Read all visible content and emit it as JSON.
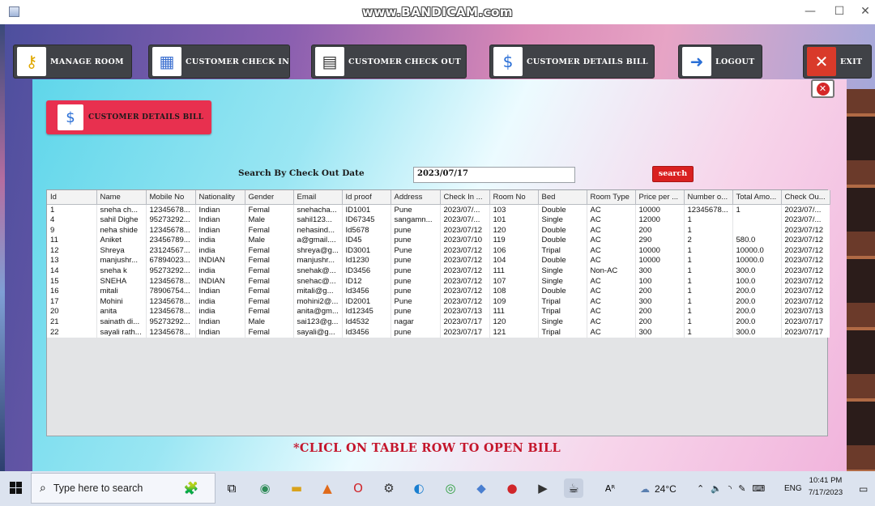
{
  "window": {
    "watermark": "www.BANDICAM.com",
    "minimize": "—",
    "maximize": "☐",
    "close": "✕"
  },
  "nav": [
    {
      "label": "MANAGE ROOM",
      "icon": "key-icon"
    },
    {
      "label": "CUSTOMER CHECK IN",
      "icon": "hotel-icon"
    },
    {
      "label": "CUSTOMER CHECK OUT",
      "icon": "checkout-icon"
    },
    {
      "label": "CUSTOMER DETAILS BILL",
      "icon": "bill-icon"
    },
    {
      "label": "LOGOUT",
      "icon": "logout-icon"
    },
    {
      "label": "EXIT",
      "icon": "exit-icon"
    }
  ],
  "header": {
    "label": "CUSTOMER DETAILS BILL"
  },
  "search": {
    "label": "Search By Check Out Date",
    "value": "2023/07/17",
    "button": "search"
  },
  "table": {
    "columns": [
      "Id",
      "Name",
      "Mobile No",
      "Nationality",
      "Gender",
      "Email",
      "Id proof",
      "Address",
      "Check In ...",
      "Room No",
      "Bed",
      "Room Type",
      "Price per ...",
      "Number o...",
      "Total Amo...",
      "Check Ou..."
    ],
    "rows": [
      [
        "1",
        "sneha ch...",
        "12345678...",
        "Indian",
        "Femal",
        "snehacha...",
        "ID1001",
        "Pune",
        "2023/07/...",
        "103",
        "Double",
        "AC",
        "10000",
        "12345678...",
        "1",
        "2023/07/..."
      ],
      [
        "4",
        "sahil Dighe",
        "95273292...",
        "Indian",
        "Male",
        "sahil123...",
        "ID67345",
        "sangamn...",
        "2023/07/...",
        "101",
        "Single",
        "AC",
        "12000",
        "1",
        "",
        "2023/07/..."
      ],
      [
        "9",
        "neha shide",
        "12345678...",
        "Indian",
        "Femal",
        "nehasind...",
        "Id5678",
        "pune",
        "2023/07/12",
        "120",
        "Double",
        "AC",
        "200",
        "1",
        "",
        "2023/07/12"
      ],
      [
        "11",
        "Aniket",
        "23456789...",
        "india",
        "Male",
        "a@gmail....",
        "ID45",
        "pune",
        "2023/07/10",
        "119",
        "Double",
        "AC",
        "290",
        "2",
        "580.0",
        "2023/07/12"
      ],
      [
        "12",
        "Shreya",
        "23124567...",
        "india",
        "Femal",
        "shreya@g...",
        "ID3001",
        "Pune",
        "2023/07/12",
        "106",
        "Tripal",
        "AC",
        "10000",
        "1",
        "10000.0",
        "2023/07/12"
      ],
      [
        "13",
        "manjushr...",
        "67894023...",
        "INDIAN",
        "Femal",
        "manjushr...",
        "Id1230",
        "pune",
        "2023/07/12",
        "104",
        "Double",
        "AC",
        "10000",
        "1",
        "10000.0",
        "2023/07/12"
      ],
      [
        "14",
        "sneha k",
        "95273292...",
        "india",
        "Femal",
        "snehak@...",
        "ID3456",
        "pune",
        "2023/07/12",
        "111",
        "Single",
        "Non-AC",
        "300",
        "1",
        "300.0",
        "2023/07/12"
      ],
      [
        "15",
        "SNEHA",
        "12345678...",
        "INDIAN",
        "Femal",
        "snehac@...",
        "ID12",
        "pune",
        "2023/07/12",
        "107",
        "Single",
        "AC",
        "100",
        "1",
        "100.0",
        "2023/07/12"
      ],
      [
        "16",
        "mitali",
        "78906754...",
        "Indian",
        "Femal",
        "mitali@g...",
        "Id3456",
        "pune",
        "2023/07/12",
        "108",
        "Double",
        "AC",
        "200",
        "1",
        "200.0",
        "2023/07/12"
      ],
      [
        "17",
        "Mohini",
        "12345678...",
        "india",
        "Femal",
        "mohini2@...",
        "ID2001",
        "Pune",
        "2023/07/12",
        "109",
        "Tripal",
        "AC",
        "300",
        "1",
        "200.0",
        "2023/07/12"
      ],
      [
        "20",
        "anita",
        "12345678...",
        "india",
        "Femal",
        "anita@gm...",
        "Id12345",
        "pune",
        "2023/07/13",
        "111",
        "Tripal",
        "AC",
        "200",
        "1",
        "200.0",
        "2023/07/13"
      ],
      [
        "21",
        "sainath di...",
        "95273292...",
        "Indian",
        "Male",
        "sai123@g...",
        "Id4532",
        "nagar",
        "2023/07/17",
        "120",
        "Single",
        "AC",
        "200",
        "1",
        "200.0",
        "2023/07/17"
      ],
      [
        "22",
        "sayali rath...",
        "12345678...",
        "Indian",
        "Femal",
        "sayali@g...",
        "Id3456",
        "pune",
        "2023/07/17",
        "121",
        "Tripal",
        "AC",
        "300",
        "1",
        "300.0",
        "2023/07/17"
      ]
    ]
  },
  "note": "*CLICL ON TABLE ROW TO OPEN BILL",
  "taskbar": {
    "search_placeholder": "Type here to search",
    "weather": "24°C",
    "language": "ENG",
    "time": "10:41 PM",
    "date": "7/17/2023"
  }
}
